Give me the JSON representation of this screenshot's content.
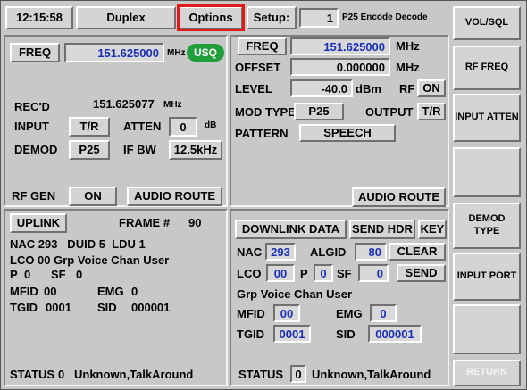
{
  "topbar": {
    "time": "12:15:58",
    "mode": "Duplex",
    "options": "Options",
    "setup_label": "Setup:",
    "setup_value": "1",
    "setup_desc": "P25 Encode Decode"
  },
  "side_buttons": {
    "vol_sql": "VOL/SQL",
    "rf_freq": "RF FREQ",
    "input_atten": "INPUT ATTEN",
    "demod_type": "DEMOD TYPE",
    "input_port": "INPUT PORT",
    "return": "RETURN"
  },
  "receiver": {
    "freq_label": "FREQ",
    "freq_value": "151.625000",
    "freq_unit": "MHz",
    "squelch_badge": "USQ",
    "recd_label": "REC'D",
    "recd_value": "151.625077",
    "recd_unit": "MHz",
    "input_label": "INPUT",
    "input_value": "T/R",
    "atten_label": "ATTEN",
    "atten_value": "0",
    "atten_unit": "dB",
    "demod_label": "DEMOD",
    "demod_value": "P25",
    "ifbw_label": "IF BW",
    "ifbw_value": "12.5kHz",
    "rfgen_label": "RF GEN",
    "rfgen_value": "ON",
    "audio_route": "AUDIO ROUTE"
  },
  "generator": {
    "freq_label": "FREQ",
    "freq_value": "151.625000",
    "freq_unit": "MHz",
    "offset_label": "OFFSET",
    "offset_value": "0.000000",
    "offset_unit": "MHz",
    "level_label": "LEVEL",
    "level_value": "-40.0",
    "level_unit": "dBm",
    "rf_label": "RF",
    "rf_value": "ON",
    "modtype_label": "MOD TYPE",
    "modtype_value": "P25",
    "output_label": "OUTPUT",
    "output_value": "T/R",
    "pattern_label": "PATTERN",
    "pattern_value": "SPEECH",
    "audio_route": "AUDIO ROUTE"
  },
  "uplink": {
    "title": "UPLINK",
    "frame_label": "FRAME #",
    "frame_value": "90",
    "line1": "NAC 293   DUID 5  LDU 1",
    "line2": "LCO 00 Grp Voice Chan User",
    "p_label": "P",
    "p_value": "0",
    "sf_label": "SF",
    "sf_value": "0",
    "mfid_label": "MFID",
    "mfid_value": "00",
    "emg_label": "EMG",
    "emg_value": "0",
    "tgid_label": "TGID",
    "tgid_value": "0001",
    "sid_label": "SID",
    "sid_value": "000001",
    "status_label": "STATUS",
    "status_value": "0",
    "status_text": "Unknown,TalkAround"
  },
  "downlink": {
    "title": "DOWNLINK DATA",
    "send_hdr": "SEND HDR",
    "key": "KEY",
    "nac_label": "NAC",
    "nac_value": "293",
    "algid_label": "ALGID",
    "algid_value": "80",
    "clear": "CLEAR",
    "lco_label": "LCO",
    "lco_value": "00",
    "p_label": "P",
    "p_value": "0",
    "sf_label": "SF",
    "sf_value": "0",
    "send": "SEND",
    "lco_desc": "Grp Voice Chan User",
    "mfid_label": "MFID",
    "mfid_value": "00",
    "emg_label": "EMG",
    "emg_value": "0",
    "tgid_label": "TGID",
    "tgid_value": "0001",
    "sid_label": "SID",
    "sid_value": "000001",
    "status_label": "STATUS",
    "status_value": "0",
    "status_text": "Unknown,TalkAround"
  },
  "colors": {
    "accent_blue": "#1a2fb8",
    "squelch_green": "#1f9e3a",
    "highlight_red": "#e01a1a",
    "panel_gray": "#c8c8c8"
  }
}
